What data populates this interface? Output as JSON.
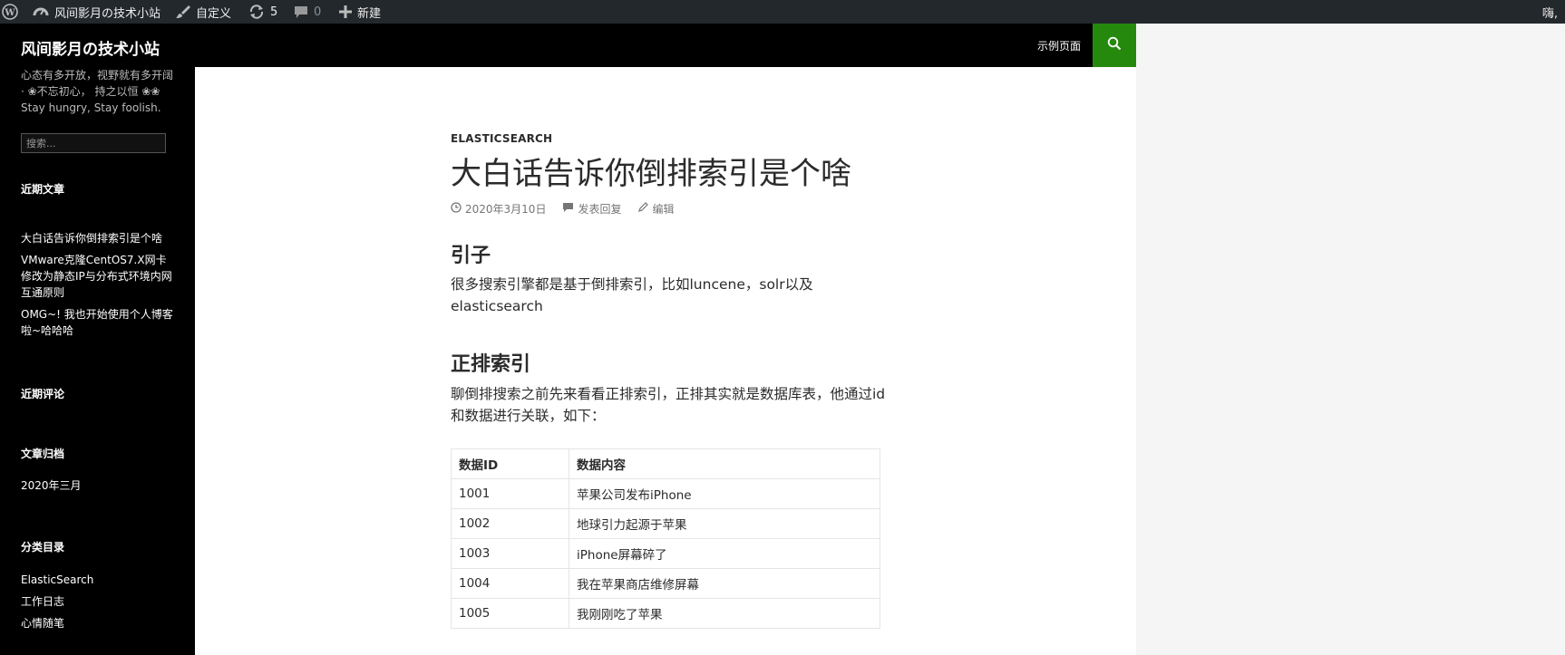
{
  "adminbar": {
    "site_name": "风间影月の技术小站",
    "customize": "自定义",
    "updates_count": "5",
    "comments_count": "0",
    "new_label": "新建",
    "greeting": "嗨,"
  },
  "sidebar": {
    "site_title": "风间影月の技术小站",
    "description": "心态有多开放，视野就有多开阔 · ❀不忘初心， 持之以恒 ❀❀ Stay hungry, Stay foolish.",
    "search_placeholder": "搜索...",
    "recent_posts_title": "近期文章",
    "recent_posts": [
      "大白话告诉你倒排索引是个啥",
      "VMware克隆CentOS7.X网卡修改为静态IP与分布式环境内网互通原则",
      "OMG~! 我也开始使用个人博客啦~哈哈哈"
    ],
    "recent_comments_title": "近期评论",
    "archives_title": "文章归档",
    "archives": [
      "2020年三月"
    ],
    "categories_title": "分类目录",
    "categories": [
      "ElasticSearch",
      "工作日志",
      "心情随笔"
    ]
  },
  "header": {
    "menu_item": "示例页面"
  },
  "post": {
    "category": "ELASTICSEARCH",
    "title": "大白话告诉你倒排索引是个啥",
    "date": "2020年3月10日",
    "reply": "发表回复",
    "edit": "编辑",
    "section1_title": "引子",
    "section1_text": "很多搜索引擎都是基于倒排索引，比如luncene，solr以及elasticsearch",
    "section2_title": "正排索引",
    "section2_text": "聊倒排搜索之前先来看看正排索引，正排其实就是数据库表，他通过id和数据进行关联，如下：",
    "table": {
      "headers": [
        "数据ID",
        "数据内容"
      ],
      "rows": [
        [
          "1001",
          "苹果公司发布iPhone"
        ],
        [
          "1002",
          "地球引力起源于苹果"
        ],
        [
          "1003",
          "iPhone屏幕碎了"
        ],
        [
          "1004",
          "我在苹果商店维修屏幕"
        ],
        [
          "1005",
          "我刚刚吃了苹果"
        ]
      ]
    }
  },
  "colors": {
    "admin_bar": "#23282d",
    "sidebar": "#000000",
    "accent_green": "#24890d"
  }
}
